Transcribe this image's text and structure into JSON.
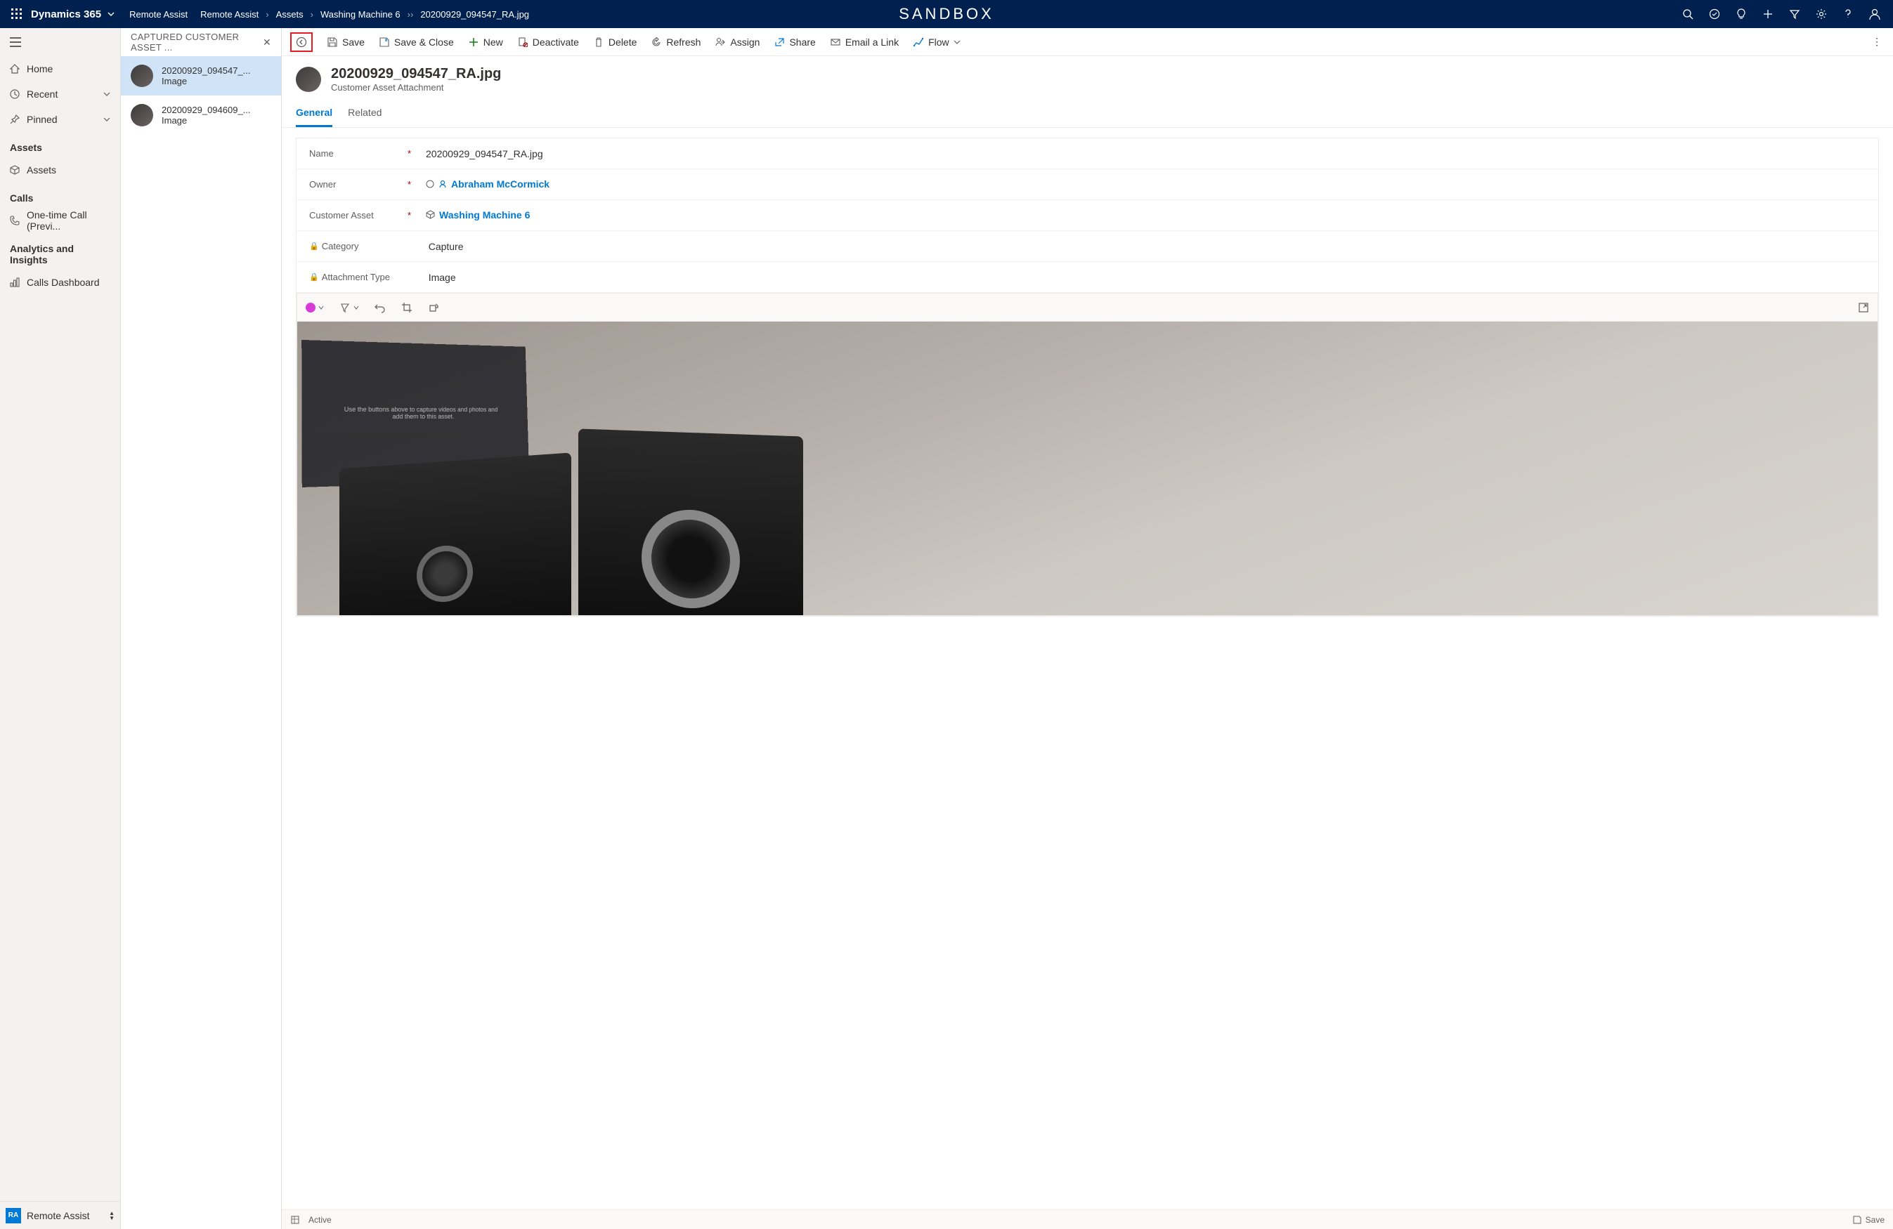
{
  "header": {
    "product": "Dynamics 365",
    "breadcrumb": [
      "Remote Assist",
      "Remote Assist",
      "Assets",
      "Washing Machine 6",
      "20200929_094547_RA.jpg"
    ],
    "center_brand": "SANDBOX"
  },
  "left_nav": {
    "items_top": [
      {
        "icon": "home",
        "label": "Home"
      },
      {
        "icon": "clock",
        "label": "Recent",
        "expandable": true
      },
      {
        "icon": "pin",
        "label": "Pinned",
        "expandable": true
      }
    ],
    "sections": [
      {
        "title": "Assets",
        "items": [
          {
            "icon": "cube",
            "label": "Assets"
          }
        ]
      },
      {
        "title": "Calls",
        "items": [
          {
            "icon": "phone",
            "label": "One-time Call (Previ..."
          }
        ]
      },
      {
        "title": "Analytics and Insights",
        "items": [
          {
            "icon": "chart",
            "label": "Calls Dashboard"
          }
        ]
      }
    ],
    "footer": {
      "badge": "RA",
      "label": "Remote Assist"
    }
  },
  "sub_panel": {
    "title": "CAPTURED CUSTOMER ASSET ...",
    "items": [
      {
        "title": "20200929_094547_...",
        "sub": "Image",
        "selected": true
      },
      {
        "title": "20200929_094609_...",
        "sub": "Image",
        "selected": false
      }
    ]
  },
  "command_bar": {
    "buttons": [
      {
        "id": "back",
        "label": "",
        "icon": "back",
        "highlighted": true
      },
      {
        "id": "save",
        "label": "Save",
        "icon": "save"
      },
      {
        "id": "save-close",
        "label": "Save & Close",
        "icon": "save-close"
      },
      {
        "id": "new",
        "label": "New",
        "icon": "plus",
        "green": true
      },
      {
        "id": "deactivate",
        "label": "Deactivate",
        "icon": "deactivate"
      },
      {
        "id": "delete",
        "label": "Delete",
        "icon": "trash"
      },
      {
        "id": "refresh",
        "label": "Refresh",
        "icon": "refresh"
      },
      {
        "id": "assign",
        "label": "Assign",
        "icon": "assign"
      },
      {
        "id": "share",
        "label": "Share",
        "icon": "share"
      },
      {
        "id": "email-link",
        "label": "Email a Link",
        "icon": "mail"
      },
      {
        "id": "flow",
        "label": "Flow",
        "icon": "flow",
        "dropdown": true
      }
    ]
  },
  "record": {
    "title": "20200929_094547_RA.jpg",
    "subtitle": "Customer Asset Attachment",
    "tabs": [
      {
        "label": "General",
        "active": true
      },
      {
        "label": "Related",
        "active": false
      }
    ],
    "fields": {
      "name": {
        "label": "Name",
        "required": true,
        "value": "20200929_094547_RA.jpg"
      },
      "owner": {
        "label": "Owner",
        "required": true,
        "value": "Abraham McCormick",
        "link": true,
        "icon": "person"
      },
      "customer_asset": {
        "label": "Customer Asset",
        "required": true,
        "value": "Washing Machine 6",
        "link": true,
        "icon": "cube"
      },
      "category": {
        "label": "Category",
        "locked": true,
        "value": "Capture"
      },
      "attachment_type": {
        "label": "Attachment Type",
        "locked": true,
        "value": "Image"
      }
    },
    "image_panel_msg": "Use the buttons above to capture videos and photos and add them to this asset."
  },
  "status_bar": {
    "status": "Active",
    "save": "Save"
  }
}
